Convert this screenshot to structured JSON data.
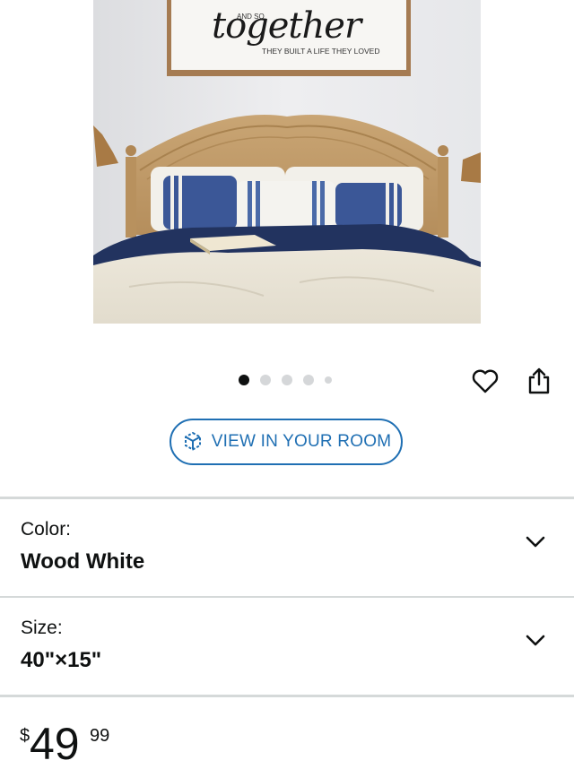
{
  "product_image": {
    "sign_small_top": "AND SO",
    "sign_script": "together",
    "sign_bottom": "THEY BUILT A LIFE THEY LOVED"
  },
  "carousel": {
    "total": 5,
    "active_index": 0
  },
  "actions": {
    "favorite_icon": "heart-icon",
    "share_icon": "share-icon"
  },
  "view_in_room": {
    "label": "VIEW IN YOUR ROOM",
    "icon": "ar-cube-icon"
  },
  "options": {
    "color": {
      "label": "Color:",
      "value": "Wood White"
    },
    "size": {
      "label": "Size:",
      "value": "40\"×15\""
    }
  },
  "price": {
    "currency": "$",
    "whole": "49",
    "fraction": "99"
  },
  "colors": {
    "accent_blue": "#1f6fb3",
    "text": "#0f1111",
    "divider": "#d5d9d9"
  }
}
